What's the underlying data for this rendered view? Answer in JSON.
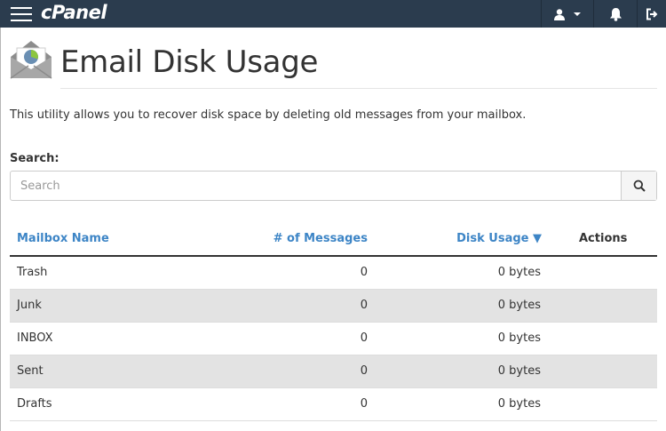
{
  "topbar": {
    "logo_text": "cPanel",
    "icons": [
      "menu-icon",
      "user-icon",
      "caret-down-icon",
      "bell-icon",
      "logout-icon"
    ]
  },
  "page": {
    "title": "Email Disk Usage",
    "description": "This utility allows you to recover disk space by deleting old messages from your mailbox.",
    "icon": "envelope-pie-chart-icon"
  },
  "search": {
    "label": "Search:",
    "placeholder": "Search",
    "value": ""
  },
  "table": {
    "columns": {
      "mailbox": "Mailbox Name",
      "messages": "# of Messages",
      "disk": "Disk Usage ▼",
      "actions": "Actions"
    },
    "rows": [
      {
        "name": "Trash",
        "messages": "0",
        "disk": "0 bytes"
      },
      {
        "name": "Junk",
        "messages": "0",
        "disk": "0 bytes"
      },
      {
        "name": "INBOX",
        "messages": "0",
        "disk": "0 bytes"
      },
      {
        "name": "Sent",
        "messages": "0",
        "disk": "0 bytes"
      },
      {
        "name": "Drafts",
        "messages": "0",
        "disk": "0 bytes"
      }
    ]
  },
  "colors": {
    "topbar": "#2b3c4e",
    "link": "#3d85c6",
    "alt_row": "#e3e3e3"
  }
}
